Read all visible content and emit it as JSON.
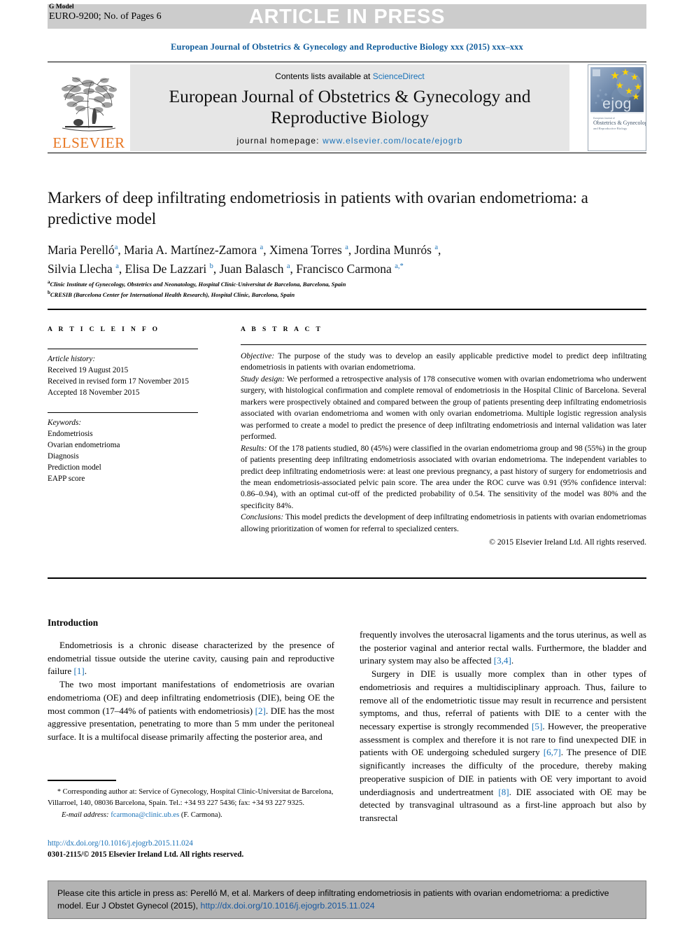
{
  "header": {
    "g_model_label": "G Model",
    "model_id": "EURO-9200; No. of Pages 6",
    "press_banner": "ARTICLE IN PRESS",
    "journal_running_head": "European Journal of Obstetrics & Gynecology and Reproductive Biology xxx (2015) xxx–xxx"
  },
  "masthead": {
    "contents_prefix": "Contents lists available at ",
    "sciencedirect": "ScienceDirect",
    "journal_title_line1": "European Journal of Obstetrics & Gynecology and",
    "journal_title_line2": "Reproductive Biology",
    "homepage_label": "journal homepage: ",
    "homepage_url": "www.elsevier.com/locate/ejogrb",
    "publisher": "ELSEVIER",
    "cover_brand": "ejog",
    "cover_sub1": "Obstetrics & Gynecology",
    "cover_sub2": "and Reproductive Biology"
  },
  "article": {
    "title": "Markers of deep infiltrating endometriosis in patients with ovarian endometrioma: a predictive model",
    "authors_line1": "Maria Perelló",
    "authors_html_line1": "Maria Perelló <sup>a</sup>, Maria A. Martínez-Zamora <sup>a</sup>, Ximena Torres <sup>a</sup>, Jordina Munrós <sup>a</sup>,",
    "authors_html_line2": "Silvia Llecha <sup>a</sup>, Elisa De Lazzari <sup>b</sup>, Juan Balasch <sup>a</sup>, Francisco Carmona <sup>a,*</sup>",
    "affiliation_a": "Clinic Institute of Gynecology, Obstetrics and Neonatology, Hospital Clínic-Universitat de Barcelona, Barcelona, Spain",
    "affiliation_b": "CRESIB (Barcelona Center for International Health Research), Hospital Clínic, Barcelona, Spain"
  },
  "article_info": {
    "heading": "A R T I C L E  I N F O",
    "history_label": "Article history:",
    "received": "Received 19 August 2015",
    "revised": "Received in revised form 17 November 2015",
    "accepted": "Accepted 18 November 2015",
    "keywords_label": "Keywords:",
    "keywords": [
      "Endometriosis",
      "Ovarian endometrioma",
      "Diagnosis",
      "Prediction model",
      "EAPP score"
    ]
  },
  "abstract": {
    "heading": "A B S T R A C T",
    "objective_label": "Objective:",
    "objective_text": " The purpose of the study was to develop an easily applicable predictive model to predict deep infiltrating endometriosis in patients with ovarian endometrioma.",
    "study_design_label": "Study design:",
    "study_design_text": " We performed a retrospective analysis of 178 consecutive women with ovarian endometrioma who underwent surgery, with histological confirmation and complete removal of endometriosis in the Hospital Clinic of Barcelona. Several markers were prospectively obtained and compared between the group of patients presenting deep infiltrating endometriosis associated with ovarian endometrioma and women with only ovarian endometrioma. Multiple logistic regression analysis was performed to create a model to predict the presence of deep infiltrating endometriosis and internal validation was later performed.",
    "results_label": "Results:",
    "results_text": " Of the 178 patients studied, 80 (45%) were classified in the ovarian endometrioma group and 98 (55%) in the group of patients presenting deep infiltrating endometriosis associated with ovarian endometrioma. The independent variables to predict deep infiltrating endometriosis were: at least one previous pregnancy, a past history of surgery for endometriosis and the mean endometriosis-associated pelvic pain score. The area under the ROC curve was 0.91 (95% confidence interval: 0.86–0.94), with an optimal cut-off of the predicted probability of 0.54. The sensitivity of the model was 80% and the specificity 84%.",
    "conclusions_label": "Conclusions:",
    "conclusions_text": " This model predicts the development of deep infiltrating endometriosis in patients with ovarian endometriomas allowing prioritization of women for referral to specialized centers.",
    "copyright": "© 2015 Elsevier Ireland Ltd. All rights reserved."
  },
  "body": {
    "intro_heading": "Introduction",
    "left_p1_a": "Endometriosis is a chronic disease characterized by the presence of endometrial tissue outside the uterine cavity, causing pain and reproductive failure ",
    "left_p1_ref": "[1]",
    "left_p1_b": ".",
    "left_p2_a": "The two most important manifestations of endometriosis are ovarian endometrioma (OE) and deep infiltrating endometriosis (DIE), being OE the most common (17–44% of patients with endometriosis) ",
    "left_p2_ref": "[2]",
    "left_p2_b": ". DIE has the most aggressive presentation, penetrating to more than 5 mm under the peritoneal surface. It is a multifocal disease primarily affecting the posterior area, and",
    "right_p1_a": "frequently involves the uterosacral ligaments and the torus uterinus, as well as the posterior vaginal and anterior rectal walls. Furthermore, the bladder and urinary system may also be affected ",
    "right_p1_ref": "[3,4]",
    "right_p1_b": ".",
    "right_p2_a": "Surgery in DIE is usually more complex than in other types of endometriosis and requires a multidisciplinary approach. Thus, failure to remove all of the endometriotic tissue may result in recurrence and persistent symptoms, and thus, referral of patients with DIE to a center with the necessary expertise is strongly recommended ",
    "right_p2_ref1": "[5]",
    "right_p2_mid1": ". However, the preoperative assessment is complex and therefore it is not rare to find unexpected DIE in patients with OE undergoing scheduled surgery ",
    "right_p2_ref2": "[6,7]",
    "right_p2_mid2": ". The presence of DIE significantly increases the difficulty of the procedure, thereby making preoperative suspicion of DIE in patients with OE very important to avoid underdiagnosis and undertreatment ",
    "right_p2_ref3": "[8]",
    "right_p2_end": ". DIE associated with OE may be detected by transvaginal ultrasound as a first-line approach but also by transrectal"
  },
  "footnote": {
    "star": "*",
    "corresponding_text": " Corresponding author at: Service of Gynecology, Hospital Clinic-Universitat de Barcelona, Villarroel, 140, 08036 Barcelona, Spain. Tel.: +34 93 227 5436; fax: +34 93 227 9325.",
    "email_label": "E-mail address:",
    "email": " fcarmona@clinic.ub.es",
    "email_owner": " (F. Carmona).",
    "doi_url": "http://dx.doi.org/10.1016/j.ejogrb.2015.11.024",
    "issn_line": "0301-2115/© 2015 Elsevier Ireland Ltd. All rights reserved."
  },
  "citation_box": {
    "text_a": "Please cite this article in press as: Perelló M, et al. Markers of deep infiltrating endometriosis in patients with ovarian endometrioma: a predictive model. Eur J Obstet Gynecol (2015), ",
    "doi": "http://dx.doi.org/10.1016/j.ejogrb.2015.11.024"
  },
  "colors": {
    "link_blue": "#1a72b8",
    "heading_blue": "#115d9c",
    "elsevier_orange": "#e87722",
    "banner_grey": "#cccccc",
    "panel_grey": "#e6e6e6",
    "cite_box_grey": "#b3b3b3"
  }
}
